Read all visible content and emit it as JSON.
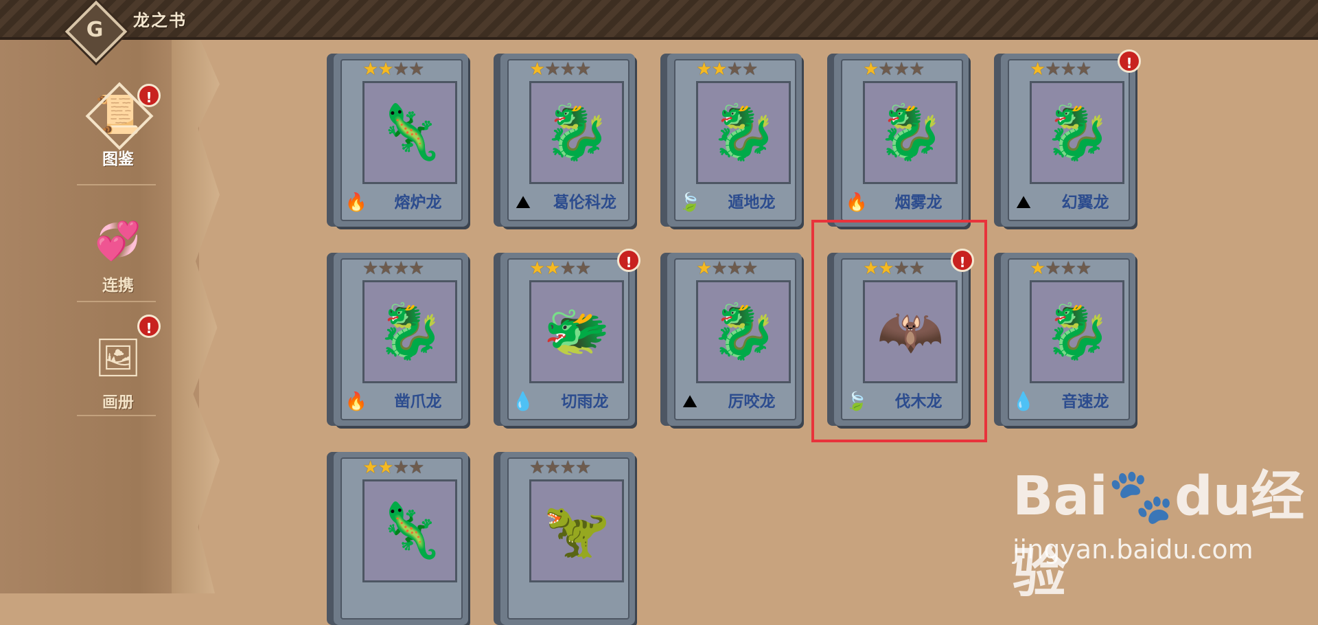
{
  "header": {
    "title": "龙之书",
    "back_glyph": "G"
  },
  "sidebar": {
    "items": [
      {
        "label": "图鉴",
        "icon": "scroll-icon",
        "active": true,
        "badge": "!"
      },
      {
        "label": "连携",
        "icon": "link-heart-icon",
        "active": false
      },
      {
        "label": "画册",
        "icon": "album-icon",
        "active": false,
        "badge": "!"
      }
    ]
  },
  "cards": [
    {
      "name": "熔炉龙",
      "stars": 2,
      "element": "fire-icon",
      "dragon_icon": "brown-spotted-dragon"
    },
    {
      "name": "葛伦科龙",
      "stars": 1,
      "element": "rock-icon",
      "dragon_icon": "purple-spotted-dragon"
    },
    {
      "name": "遁地龙",
      "stars": 2,
      "element": "leaf-icon",
      "dragon_icon": "green-serpent-dragon"
    },
    {
      "name": "烟雾龙",
      "stars": 1,
      "element": "fire-icon",
      "dragon_icon": "blue-winged-dragon"
    },
    {
      "name": "幻翼龙",
      "stars": 1,
      "element": "rock-icon",
      "dragon_icon": "red-winged-dragon",
      "badge": "!"
    },
    {
      "name": "凿爪龙",
      "stars": 0,
      "element": "fire-icon",
      "dragon_icon": "purple-clawed-dragon"
    },
    {
      "name": "切雨龙",
      "stars": 2,
      "element": "water-icon",
      "dragon_icon": "teal-horned-dragon",
      "badge": "!"
    },
    {
      "name": "厉咬龙",
      "stars": 1,
      "element": "rock-icon",
      "dragon_icon": "magenta-winged-dragon"
    },
    {
      "name": "伐木龙",
      "stars": 2,
      "element": "leaf-icon",
      "dragon_icon": "brown-bat-dragon",
      "badge": "!",
      "selected": true
    },
    {
      "name": "音速龙",
      "stars": 1,
      "element": "water-icon",
      "dragon_icon": "cyan-sea-dragon"
    },
    {
      "name": "",
      "stars": 2,
      "element": "",
      "dragon_icon": "striped-green-dragon"
    },
    {
      "name": "",
      "stars": 0,
      "element": "",
      "dragon_icon": "lime-spiked-dragon"
    }
  ],
  "watermark": {
    "logo": "Bai🐾du经验",
    "url": "jingyan.baidu.com"
  },
  "colors": {
    "highlight": "#e8333b",
    "name_text": "#2c4c8e",
    "star_on": "#f5b922",
    "badge": "#c8221f"
  }
}
